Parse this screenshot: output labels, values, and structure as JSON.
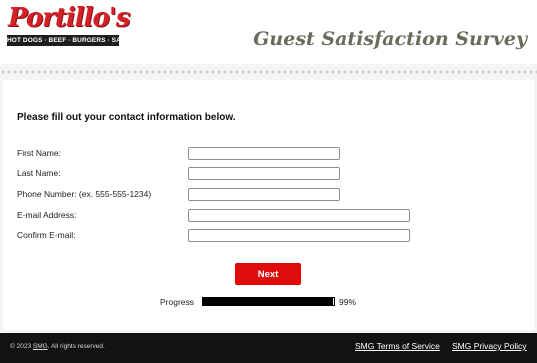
{
  "header": {
    "logo_name": "Portillo's",
    "logo_tagline": "HOT DOGS · BEEF · BURGERS · SALADS",
    "survey_title": "Guest Satisfaction Survey"
  },
  "form": {
    "instructions": "Please fill out your contact information below.",
    "fields": [
      {
        "label": "First Name:",
        "value": ""
      },
      {
        "label": "Last Name:",
        "value": ""
      },
      {
        "label": "Phone Number: (ex. 555-555-1234)",
        "value": ""
      },
      {
        "label": "E-mail Address:",
        "value": ""
      },
      {
        "label": "Confirm E-mail:",
        "value": ""
      }
    ],
    "next_label": "Next"
  },
  "progress": {
    "label": "Progress",
    "percent_text": "99%",
    "fraction": 0.99
  },
  "footer": {
    "copyright_prefix": "© 2023 ",
    "copyright_smg": "SMG",
    "copyright_suffix": ". All rights reserved.",
    "terms_link": "SMG Terms of Service",
    "privacy_link": "SMG Privacy Policy"
  },
  "colors": {
    "brand_red": "#d42127",
    "button_red": "#e00b0b",
    "footer_bg": "#121212",
    "progress_fill": "#000000"
  }
}
